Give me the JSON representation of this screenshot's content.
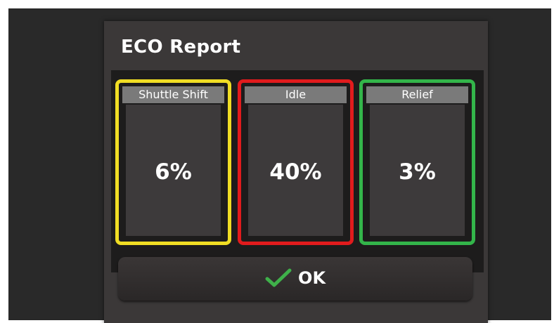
{
  "dialog": {
    "title": "ECO Report"
  },
  "cards": [
    {
      "label": "Shuttle Shift",
      "value": "6%",
      "color": "#f0dd24"
    },
    {
      "label": "Idle",
      "value": "40%",
      "color": "#e11b1d"
    },
    {
      "label": "Relief",
      "value": "3%",
      "color": "#33b54a"
    }
  ],
  "ok_button": {
    "label": "OK",
    "icon": "check-icon",
    "icon_color": "#3fb04a"
  }
}
